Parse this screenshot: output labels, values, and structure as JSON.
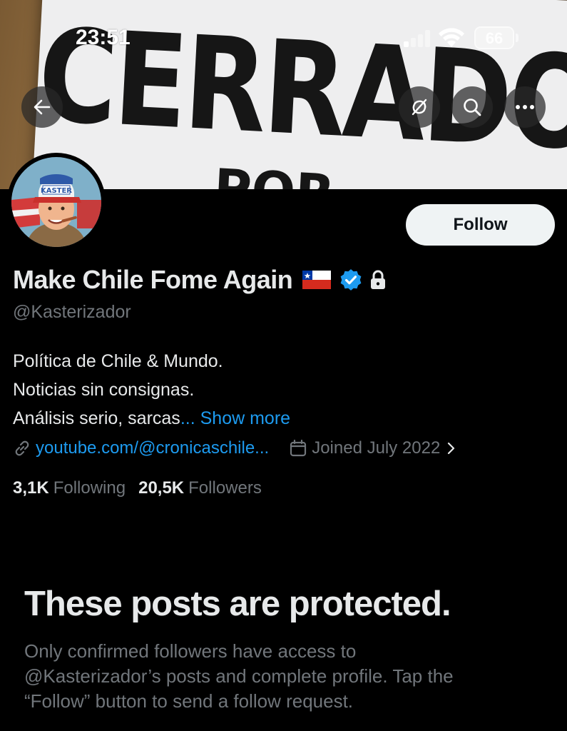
{
  "status_bar": {
    "time": "23:51",
    "battery": "66"
  },
  "banner": {
    "sign_text": "CERRADO",
    "sign_sub": "POR"
  },
  "header": {
    "back_icon": "arrow-left-icon",
    "translate_icon": "no-translate-icon",
    "search_icon": "search-icon",
    "more_icon": "more-icon"
  },
  "avatar": {
    "cap_text": "KASTER"
  },
  "profile": {
    "name": "Make Chile Fome Again",
    "handle": "@Kasterizador",
    "follow_label": "Follow",
    "bio": {
      "line1": "Política de Chile & Mundo.",
      "line2": "Noticias sin consignas.",
      "line3": "Análisis serio, sarcas",
      "ellipsis": "...",
      "show_more": "Show more"
    },
    "link": "youtube.com/@cronicaschile...",
    "joined": "Joined July 2022",
    "following_count": "3,1K",
    "following_label": "Following",
    "followers_count": "20,5K",
    "followers_label": "Followers"
  },
  "protected": {
    "title": "These posts are protected.",
    "line1": "Only confirmed followers have access to",
    "line2": "@Kasterizador’s posts and complete profile. Tap the",
    "line3": "“Follow” button to send a follow request."
  },
  "colors": {
    "accent": "#1d9bf0",
    "background": "#000000",
    "secondary_text": "#71767b",
    "primary_text": "#e7e9ea"
  }
}
